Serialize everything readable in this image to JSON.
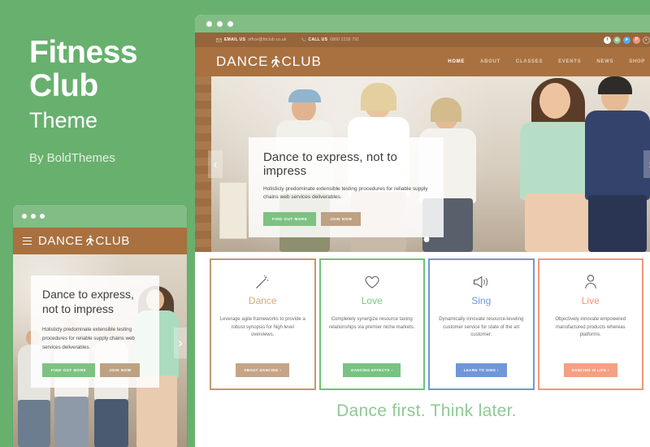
{
  "promo": {
    "title_line1": "Fitness",
    "title_line2": "Club",
    "subtitle": "Theme",
    "author": "By BoldThemes"
  },
  "colors": {
    "background_green": "#68b06e",
    "brand_brown": "#a9713f",
    "topbar_brown": "#96653b",
    "accent_green": "#7dc283",
    "accent_tan": "#bda183",
    "card_dance": "#bd9a74",
    "card_love": "#72c07c",
    "card_sing": "#6f97d8",
    "card_live": "#f2977a"
  },
  "desktop": {
    "topbar": {
      "email_label": "EMAIL US",
      "email_value": "office@fitclub.co.uk",
      "phone_label": "CALL US",
      "phone_value": "0800 2236 791",
      "socials": [
        {
          "name": "facebook-icon",
          "glyph": "f",
          "color": "#ffffff"
        },
        {
          "name": "instagram-icon",
          "glyph": "◎",
          "color": "#8cc48f"
        },
        {
          "name": "twitter-icon",
          "glyph": "➤",
          "color": "#55acee"
        },
        {
          "name": "pinterest-icon",
          "glyph": "P",
          "color": "#f2977a"
        },
        {
          "name": "search-icon",
          "glyph": "⌕",
          "color": "transparent"
        }
      ]
    },
    "logo": {
      "word1": "DANCE",
      "word2": "CLUB",
      "icon": "dancer-icon"
    },
    "menu": [
      {
        "label": "HOME",
        "active": true
      },
      {
        "label": "ABOUT",
        "active": false
      },
      {
        "label": "CLASSES",
        "active": false
      },
      {
        "label": "EVENTS",
        "active": false
      },
      {
        "label": "NEWS",
        "active": false
      },
      {
        "label": "SHOP",
        "active": false
      }
    ],
    "hero": {
      "heading": "Dance to express, not to impress",
      "body": "Holisticly predominate extensible testing procedures for reliable supply chains web services deliverables.",
      "primary_button": "FIND OUT MORE",
      "secondary_button": "JOIN NOW",
      "prev_arrow": "‹",
      "next_arrow": "›",
      "dots_total": 1,
      "active_dot": 1
    },
    "cards": [
      {
        "icon": "magic-wand-icon",
        "title": "Dance",
        "body": "Leverage agile frameworks to provide a robust synopsis for high level overviews.",
        "button": "ABOUT DANCING  ›"
      },
      {
        "icon": "heart-icon",
        "title": "Love",
        "body": "Completely synergize resource taxing relationships via premier niche markets.",
        "button": "DANCING EFFECTS  ›"
      },
      {
        "icon": "megaphone-icon",
        "title": "Sing",
        "body": "Dynamically innovate resource-leveling customer service for state of the art customer.",
        "button": "LEARN TO SING  ›"
      },
      {
        "icon": "user-icon",
        "title": "Live",
        "body": "Objectively innovate empowered manufactured products whereas platforms.",
        "button": "DANCING IS LIFE  ›"
      }
    ],
    "tagline": "Dance first. Think later."
  },
  "mobile": {
    "logo": {
      "word1": "DANCE",
      "word2": "CLUB",
      "icon": "dancer-icon"
    },
    "menu_icon": "hamburger-icon",
    "hero": {
      "heading_line1": "Dance to express,",
      "heading_line2": "not to impress",
      "body": "Holisticly predominate extensible testing procedures for reliable supply chains web services deliverables.",
      "primary_button": "FIND OUT MORE",
      "secondary_button": "JOIN NOW",
      "next_arrow": "›"
    }
  }
}
